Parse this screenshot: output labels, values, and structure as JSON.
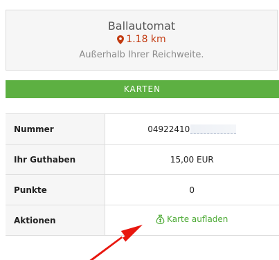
{
  "location": {
    "name": "Ballautomat",
    "distance": "1.18 km",
    "status": "Außerhalb Ihrer Reichweite.",
    "icon": "map-marker-icon"
  },
  "section": {
    "title": "KARTEN"
  },
  "card_table": {
    "rows": [
      {
        "label": "Nummer",
        "value": "04922410"
      },
      {
        "label": "Ihr Guthaben",
        "value": "15,00 EUR"
      },
      {
        "label": "Punkte",
        "value": "0"
      },
      {
        "label": "Aktionen",
        "value": "Karte aufladen",
        "icon": "money-bag-icon"
      }
    ]
  },
  "colors": {
    "accent_green": "#5db042",
    "link_green": "#4caa34",
    "distance_red": "#c23a10",
    "annotation_red": "#e8170f"
  }
}
